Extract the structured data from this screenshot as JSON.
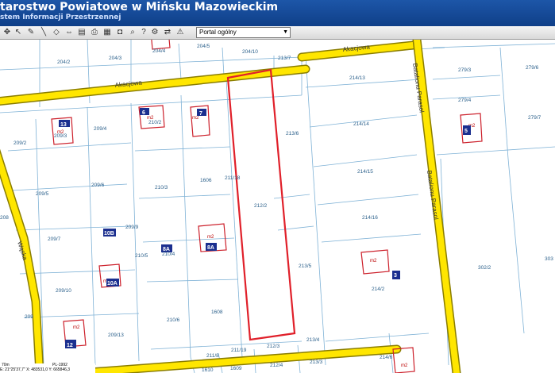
{
  "header": {
    "title": "tarostwo Powiatowe w Mińsku Mazowieckim",
    "subtitle": "stem Informacji Przestrzennej"
  },
  "toolbar": {
    "tools": [
      "pan-icon",
      "select-icon",
      "draw-icon",
      "measure-line-icon",
      "measure-area-icon",
      "zoom-extent-icon",
      "layers-icon",
      "print-icon",
      "identify-icon",
      "help-icon",
      "search-icon",
      "settings-icon",
      "export-icon",
      "cart-icon"
    ],
    "portal_select": "Portal ogólny"
  },
  "map": {
    "streets": [
      "Akacjowa",
      "Akacjowa",
      "Batalionu Parasol",
      "Batalionu Parasol",
      "Wąska"
    ],
    "parcels": [
      "204/2",
      "204/3",
      "204/4",
      "204/5",
      "204/10",
      "213/7",
      "214/13",
      "279/3",
      "279/6",
      "279/4",
      "279/7",
      "209/2",
      "209/3",
      "209/4",
      "210/2",
      "213/6",
      "214/14",
      "214/15",
      "209/5",
      "209/6",
      "210/3",
      "1606",
      "211/18",
      "212/2",
      "214/16",
      "209/7",
      "209/9",
      "210/5",
      "210/4",
      "213/5",
      "302/2",
      "303",
      "209/10",
      "209/13",
      "210/6",
      "1608",
      "213/4",
      "214/2",
      "211/8",
      "211/19",
      "212/3",
      "212/4",
      "213/3",
      "214/6",
      "1610",
      "1609",
      "208",
      "209"
    ],
    "building_labels": [
      "m2",
      "m2",
      "m2",
      "m2",
      "m2",
      "m2",
      "m2",
      "m2",
      "m2",
      "m2"
    ],
    "house_numbers": [
      "13",
      "6",
      "7",
      "10B",
      "8A",
      "8A",
      "10A",
      "12",
      "5",
      "3"
    ]
  },
  "status": {
    "coords": "E: 21°25'37,7\" X: 483531,0 Y: 665846,3",
    "scale": "PL-1992",
    "scale_bar": "70m"
  }
}
